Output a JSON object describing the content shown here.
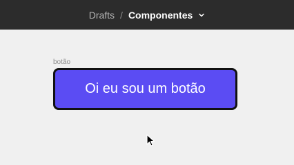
{
  "header": {
    "breadcrumb_root": "Drafts",
    "separator": "/",
    "current_file": "Componentes",
    "dropdown_icon": "chevron-down-icon"
  },
  "canvas": {
    "frame_label": "botão",
    "button_label": "Oi eu sou um botão",
    "cursor_icon": "arrow-cursor-icon"
  },
  "colors": {
    "topbar_bg": "#2c2c2c",
    "canvas_bg": "#f0f0f0",
    "button_fill": "#5b4cf3",
    "button_border": "#111111",
    "button_text": "#ffffff"
  }
}
